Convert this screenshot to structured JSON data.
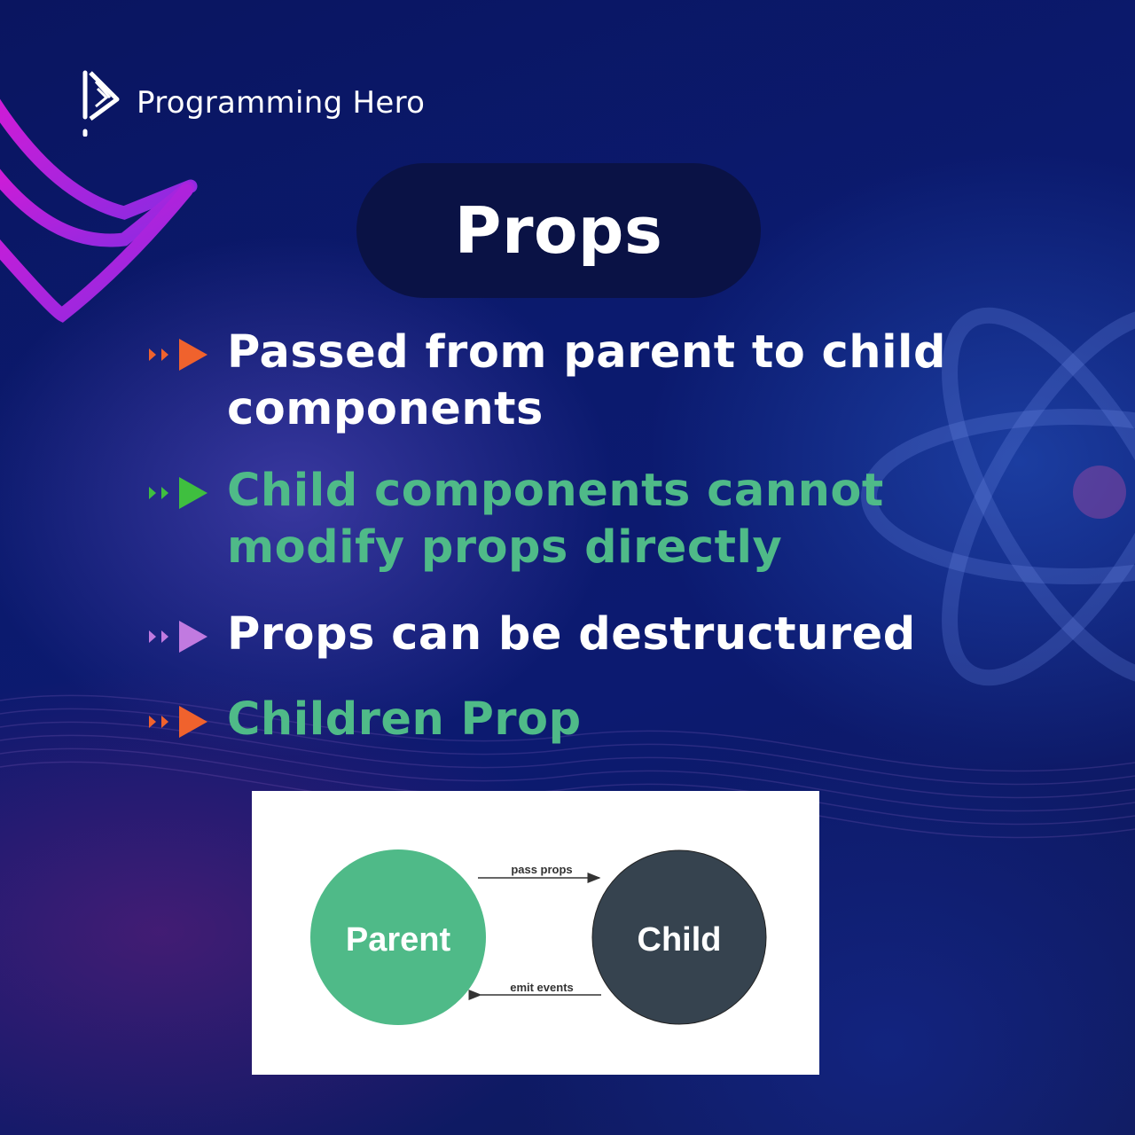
{
  "brand": {
    "name": "Programming Hero",
    "logo_icon": "programming-hero-logo-icon"
  },
  "title": "Props",
  "bullets": [
    {
      "lines": [
        "Passed from parent to child",
        "components"
      ],
      "icon_color": "#f0622d",
      "text_color": "#ffffff"
    },
    {
      "lines": [
        "Child components cannot",
        "modify props directly"
      ],
      "icon_color": "#3fbf3f",
      "text_color": "#4fba88"
    },
    {
      "lines": [
        "Props can be destructured"
      ],
      "icon_color": "#c17ae0",
      "text_color": "#ffffff"
    },
    {
      "lines": [
        "Children Prop"
      ],
      "icon_color": "#f0622d",
      "text_color": "#4fba88"
    }
  ],
  "diagram": {
    "parent_label": "Parent",
    "child_label": "Child",
    "pass_label": "pass props",
    "emit_label": "emit events",
    "parent_color": "#4fba88",
    "child_color": "#36434f"
  }
}
